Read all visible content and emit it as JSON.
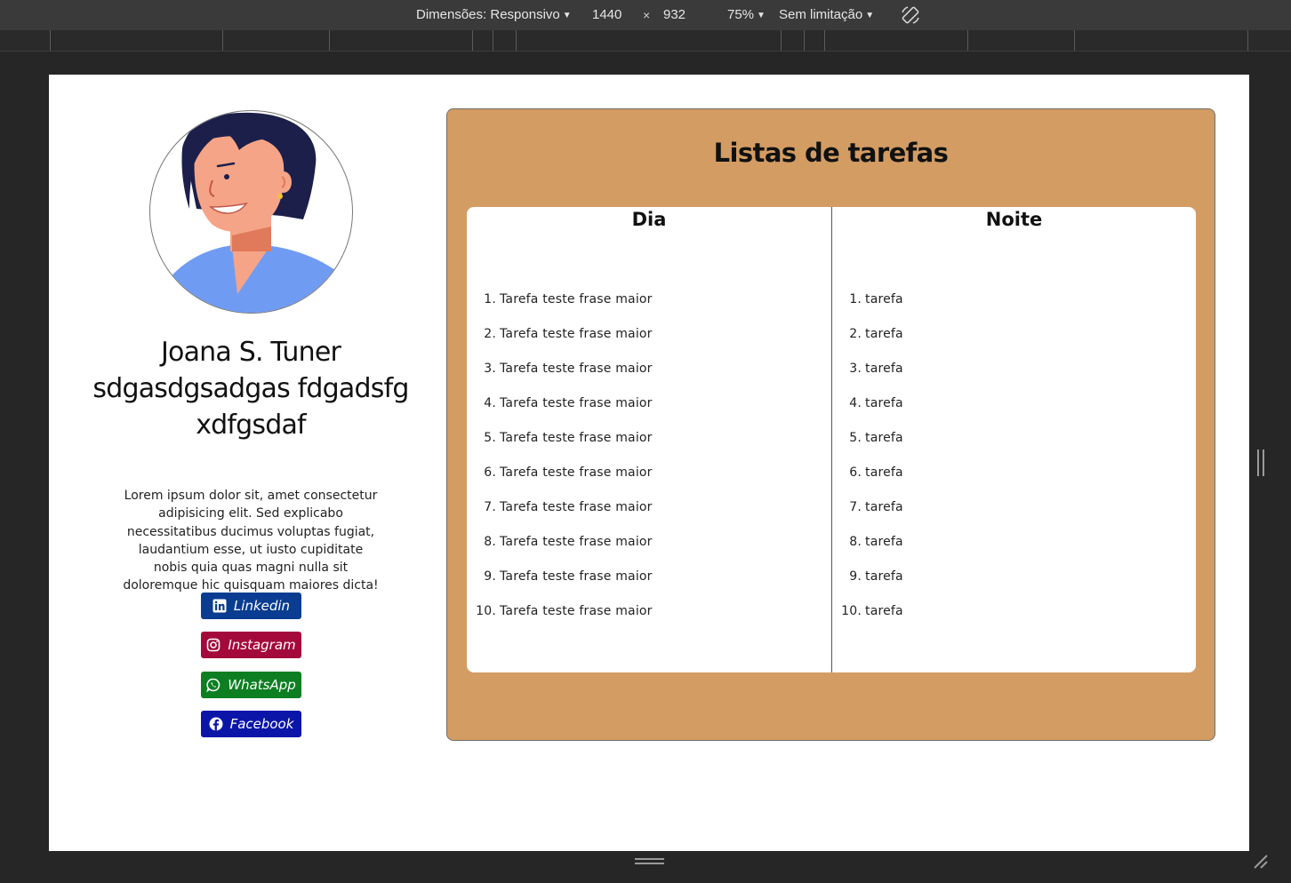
{
  "devtools": {
    "dimensions_label": "Dimensões: Responsivo",
    "width_value": "1440",
    "times_symbol": "×",
    "height_value": "932",
    "zoom_label": "75%",
    "throttle_label": "Sem limitação",
    "rotate_icon": "rotate-icon"
  },
  "profile": {
    "name": "Joana S. Tuner sdgasdgsadgas fdgadsfg xdfgsdaf",
    "description": "Lorem ipsum dolor sit, amet consectetur adipisicing elit. Sed explicabo necessitatibus ducimus voluptas fugiat, laudantium esse, ut iusto cupiditate nobis quia quas magni nulla sit doloremque hic quisquam maiores dicta!",
    "links": [
      {
        "label": "Linkedin",
        "icon": "linkedin-icon",
        "color": "#0a3d91"
      },
      {
        "label": "Instagram",
        "icon": "instagram-icon",
        "color": "#a30a3b"
      },
      {
        "label": "WhatsApp",
        "icon": "whatsapp-icon",
        "color": "#0d7f22"
      },
      {
        "label": "Facebook",
        "icon": "facebook-icon",
        "color": "#0b16a8"
      }
    ]
  },
  "tasks": {
    "title": "Listas de tarefas",
    "panel_color": "#d39c63",
    "day": {
      "heading": "Dia",
      "items": [
        "Tarefa teste frase maior",
        "Tarefa teste frase maior",
        "Tarefa teste frase maior",
        "Tarefa teste frase maior",
        "Tarefa teste frase maior",
        "Tarefa teste frase maior",
        "Tarefa teste frase maior",
        "Tarefa teste frase maior",
        "Tarefa teste frase maior",
        "Tarefa teste frase maior"
      ]
    },
    "night": {
      "heading": "Noite",
      "items": [
        "tarefa",
        "tarefa",
        "tarefa",
        "tarefa",
        "tarefa",
        "tarefa",
        "tarefa",
        "tarefa",
        "tarefa",
        "tarefa"
      ]
    }
  }
}
